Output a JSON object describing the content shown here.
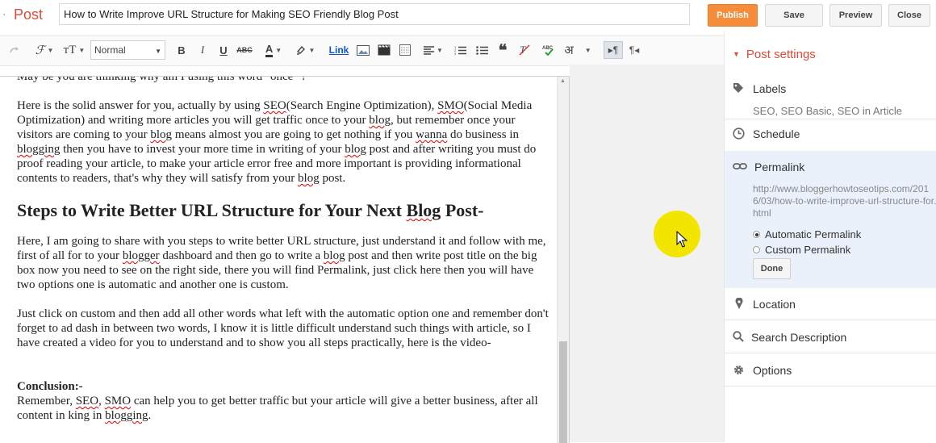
{
  "header": {
    "crumb": "·",
    "post_label": "Post",
    "title_value": "How to Write Improve URL Structure for Making SEO Friendly Blog Post",
    "buttons": {
      "publish": "Publish",
      "save": "Save",
      "preview": "Preview",
      "close": "Close"
    },
    "colors": {
      "accent": "#dd4b39",
      "publish": "#f58d3b"
    }
  },
  "toolbar": {
    "format_value": "Normal",
    "link_label": "Link",
    "hindi_glyph": "अ",
    "icons": [
      "redo-icon",
      "font-family-icon",
      "font-size-icon",
      "bold-icon",
      "italic-icon",
      "underline-icon",
      "strikethrough-icon",
      "text-color-icon",
      "highlight-color-icon",
      "link",
      "insert-image-icon",
      "insert-video-icon",
      "insert-jump-break-icon",
      "align-icon",
      "numbered-list-icon",
      "bulleted-list-icon",
      "quote-icon",
      "clear-formatting-icon",
      "spell-check-icon",
      "transliteration-icon",
      "ltr-icon",
      "rtl-icon"
    ]
  },
  "editor": {
    "line_top": "May be you are thinking why am I using this word \"once\" ?",
    "para1": [
      {
        "t": "Here is the solid answer for you, actually by using "
      },
      {
        "t": "SEO",
        "sq": true
      },
      {
        "t": "(Search Engine Optimization), "
      },
      {
        "t": "SMO",
        "sq": true
      },
      {
        "t": "(Social Media Optimization) and writing more articles you will get traffic once to your "
      },
      {
        "t": "blog",
        "sq": true
      },
      {
        "t": ", but remember once your visitors are coming to your "
      },
      {
        "t": "blog",
        "sq": true
      },
      {
        "t": " means almost you are going to get nothing if you "
      },
      {
        "t": "wanna",
        "sq": true
      },
      {
        "t": " do business in "
      },
      {
        "t": "blogging",
        "sq": true
      },
      {
        "t": " then you have to invest your more time in writing of your "
      },
      {
        "t": "blog",
        "sq": true
      },
      {
        "t": " post and after writing you must do proof reading your article, to make your article error free and more important is providing informational contents to readers, that's why they will satisfy from your "
      },
      {
        "t": "blog",
        "sq": true
      },
      {
        "t": " post."
      }
    ],
    "heading": [
      {
        "t": "Steps to Write Better URL Structure for Your Next "
      },
      {
        "t": "Blog",
        "sq": true
      },
      {
        "t": " Post-"
      }
    ],
    "para2": [
      {
        "t": "Here, I am going to share with you steps to write better URL structure, just understand it and follow with me, first of all for to your "
      },
      {
        "t": "blogger",
        "sq": true
      },
      {
        "t": " dashboard and then go to write a "
      },
      {
        "t": "blog",
        "sq": true
      },
      {
        "t": " post and then write post title on the big box now you need to see on the right side, there you will find Permalink, just click here then you will have two options one is automatic and another one is custom."
      }
    ],
    "para3": [
      {
        "t": "Just click on custom and then add all other words what left with the automatic option one and remember don't forget to ad dash in between two words, I know it is little difficult understand such things with article, so I have created a video for you to understand and to show you all steps practically, here is the video-"
      }
    ],
    "conclusion_label": "Conclusion:-",
    "para4": [
      {
        "t": "Remember, "
      },
      {
        "t": "SEO",
        "sq": true
      },
      {
        "t": ", "
      },
      {
        "t": "SMO",
        "sq": true
      },
      {
        "t": " can help you to get better traffic but your article will give a better business, after all content in king in "
      },
      {
        "t": "blogging",
        "sq": true
      },
      {
        "t": "."
      }
    ]
  },
  "sidebar": {
    "title": "Post settings",
    "labels": {
      "label": "Labels",
      "value": "SEO, SEO Basic, SEO in Article"
    },
    "schedule": "Schedule",
    "permalink": {
      "label": "Permalink",
      "url": "http://www.bloggerhowtoseotips.com/2016/03/how-to-write-improve-url-structure-for.html",
      "options": [
        "Automatic Permalink",
        "Custom Permalink"
      ],
      "selected": "Automatic Permalink",
      "done": "Done"
    },
    "location": "Location",
    "search_description": "Search Description",
    "options": "Options"
  }
}
